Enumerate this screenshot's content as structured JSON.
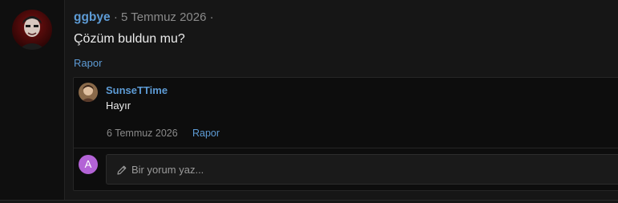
{
  "post": {
    "author": "ggbye",
    "separator": "·",
    "date": "5 Temmuz 2026",
    "trailing_separator": "·",
    "body": "Çözüm buldun mu?",
    "report_label": "Rapor",
    "avatar_icon": "user-avatar-photo"
  },
  "reply": {
    "author": "SunseTTime",
    "body": "Hayır",
    "date": "6 Temmuz 2026",
    "report_label": "Rapor",
    "avatar_icon": "user-avatar-photo"
  },
  "comment": {
    "user_initial": "A",
    "placeholder": "Bir yorum yaz...",
    "icon": "pencil-icon"
  },
  "colors": {
    "link": "#5d9bd5",
    "background": "#161616",
    "initial_avatar": "#b363d6"
  }
}
